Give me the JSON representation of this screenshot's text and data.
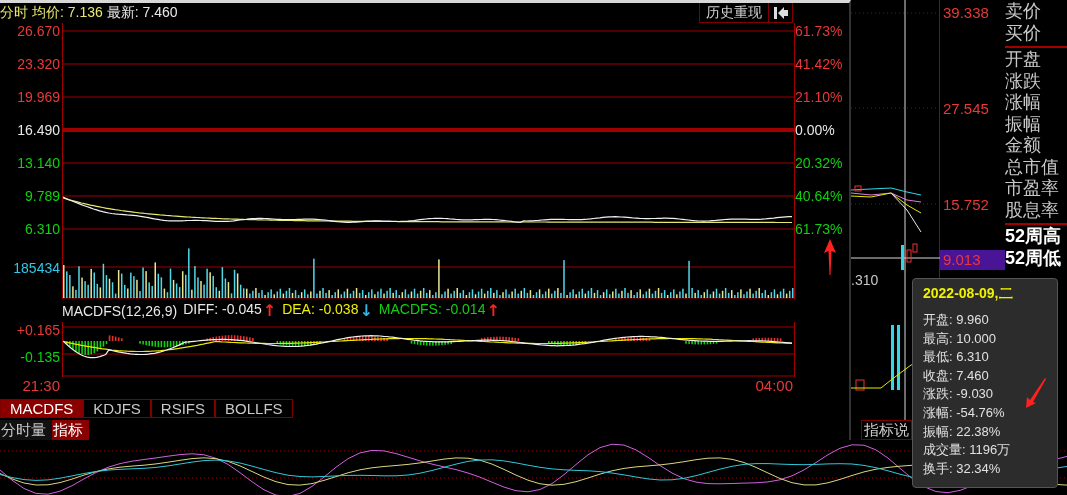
{
  "popup": {
    "header": {
      "title": "分时",
      "avg_label": "均价: 7.136",
      "latest_label": "最新: 7.460",
      "history_button": "历史重现"
    },
    "price_ticks": [
      {
        "label": "26.670",
        "color": "#e83838"
      },
      {
        "label": "23.320",
        "color": "#e83838"
      },
      {
        "label": "19.969",
        "color": "#e83838"
      },
      {
        "label": "16.490",
        "color": "#e8e8e8"
      },
      {
        "label": "13.140",
        "color": "#10d010"
      },
      {
        "label": "9.789",
        "color": "#10d010"
      },
      {
        "label": "6.310",
        "color": "#10d010"
      }
    ],
    "pct_ticks": [
      {
        "label": "61.73%",
        "color": "#e83838"
      },
      {
        "label": "41.42%",
        "color": "#e83838"
      },
      {
        "label": "21.10%",
        "color": "#e83838"
      },
      {
        "label": "0.00%",
        "color": "#e8e8e8"
      },
      {
        "label": "20.32%",
        "color": "#10d010"
      },
      {
        "label": "40.64%",
        "color": "#10d010"
      },
      {
        "label": "61.73%",
        "color": "#10d010"
      }
    ],
    "volume_tick": "185434",
    "macd": {
      "name": "MACDFS(12,26,9)",
      "values": [
        {
          "text": "DIFF: -0.045",
          "color": "#e8e8e8",
          "arrow": {
            "text": "↑",
            "color": "#ff2020"
          }
        },
        {
          "text": "DEA: -0.038",
          "color": "#f0f000",
          "arrow": {
            "text": "↓",
            "color": "#30b8e8"
          }
        },
        {
          "text": "MACDFS: -0.014",
          "color": "#10d010",
          "arrow": {
            "text": "↑",
            "color": "#ff2020"
          }
        }
      ],
      "ticks": [
        {
          "label": "+0.165",
          "color": "#e83838"
        },
        {
          "label": "-0.135",
          "color": "#10d010"
        }
      ]
    },
    "time_start": "21:30",
    "time_end": "04:00",
    "indicator_tabs": [
      {
        "label": "MACDFS",
        "selected": true
      },
      {
        "label": "KDJFS",
        "selected": false
      },
      {
        "label": "RSIFS",
        "selected": false
      },
      {
        "label": "BOLLFS",
        "selected": false
      }
    ],
    "view_tabs": [
      {
        "label": "分时量",
        "selected": false
      },
      {
        "label": "指标",
        "selected": true
      }
    ]
  },
  "kline": {
    "low_label": ".310",
    "indicator_button": "指标说"
  },
  "price_axis": [
    {
      "label": "39.338",
      "highlighted": false
    },
    {
      "label": "27.545",
      "highlighted": false
    },
    {
      "label": "15.752",
      "highlighted": false
    },
    {
      "label": "9.013",
      "highlighted": true
    }
  ],
  "quote_groups": [
    {
      "emphasis": false,
      "items": [
        "卖价",
        "买价"
      ]
    },
    {
      "emphasis": false,
      "items": [
        "开盘",
        "涨跌",
        "涨幅",
        "振幅",
        "金额",
        "总市值",
        "市盈率",
        "股息率"
      ]
    },
    {
      "emphasis": true,
      "items": [
        "52周高",
        "52周低"
      ]
    }
  ],
  "tooltip": {
    "date": "2022-08-09,二",
    "rows": [
      "开盘: 9.960",
      "最高: 10.000",
      "最低: 6.310",
      "收盘: 7.460",
      "涨跌: -9.030",
      "涨幅: -54.76%",
      "振幅: 22.38%",
      "成交量: 1196万",
      "换手: 32.34%"
    ]
  }
}
